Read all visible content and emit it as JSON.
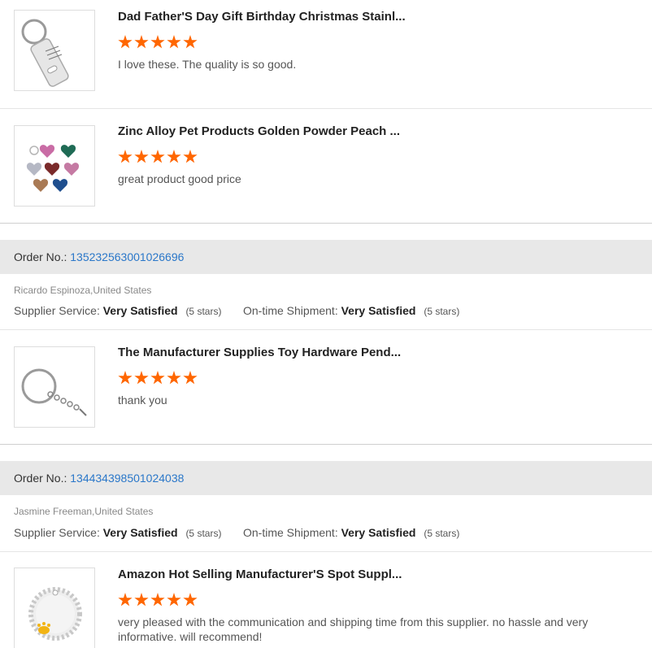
{
  "products": [
    {
      "title": "Dad Father'S Day Gift Birthday Christmas Stainl...",
      "review": "I love these. The quality is so good.",
      "image": "keychain-bottle-opener-tag"
    },
    {
      "title": "Zinc Alloy Pet Products Golden Powder Peach ...",
      "review": "great product good price",
      "image": "heart-pet-tags"
    },
    {
      "title": "The Manufacturer Supplies Toy Hardware Pend...",
      "review": "thank you",
      "image": "keyring-chain"
    },
    {
      "title": "Amazon Hot Selling Manufacturer'S Spot Suppl...",
      "review": "very pleased with the communication and shipping time from this supplier. no hassle and very informative. will recommend!",
      "image": "round-rhinestone-tag"
    }
  ],
  "star_rating": 5,
  "orders": [
    {
      "label": "Order No.:",
      "number": "135232563001026696",
      "buyer": "Ricardo Espinoza,United States",
      "supplier_label": "Supplier Service:",
      "supplier_value": "Very Satisfied",
      "supplier_stars": "(5 stars)",
      "shipment_label": "On-time Shipment:",
      "shipment_value": "Very Satisfied",
      "shipment_stars": "(5 stars)"
    },
    {
      "label": "Order No.:",
      "number": "134434398501024038",
      "buyer": "Jasmine Freeman,United States",
      "supplier_label": "Supplier Service:",
      "supplier_value": "Very Satisfied",
      "supplier_stars": "(5 stars)",
      "shipment_label": "On-time Shipment:",
      "shipment_value": "Very Satisfied",
      "shipment_stars": "(5 stars)"
    }
  ],
  "colors": {
    "star": "#ff6600",
    "link": "#2a77c9",
    "orderbar": "#e8e8e8"
  }
}
